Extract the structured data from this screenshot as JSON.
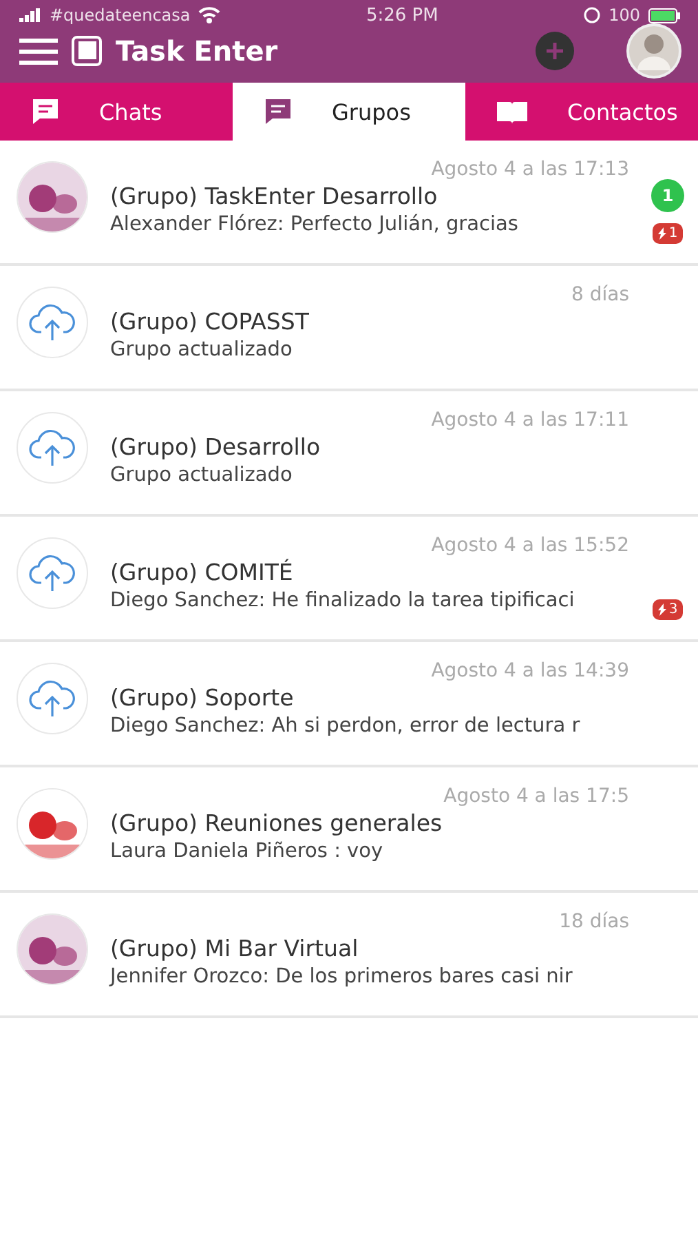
{
  "status_bar": {
    "carrier": "#quedateencasa",
    "time": "5:26 PM",
    "battery": "100"
  },
  "header": {
    "title": "Task Enter"
  },
  "tabs": [
    {
      "label": "Chats",
      "kind": "chat",
      "selected": false
    },
    {
      "label": "Grupos",
      "kind": "chat",
      "selected": true
    },
    {
      "label": "Contactos",
      "kind": "book",
      "selected": false
    }
  ],
  "groups": [
    {
      "kind": "picture",
      "name": "(Grupo) TaskEnter Desarrollo",
      "time": "Agosto 4 a las 17:13",
      "preview": "Alexander Flórez: Perfecto Julián, gracias",
      "unread": "1",
      "flags": "1"
    },
    {
      "kind": "cloud",
      "name": "(Grupo) COPASST",
      "time": "8 días",
      "preview": "Grupo actualizado"
    },
    {
      "kind": "cloud",
      "name": "(Grupo) Desarrollo",
      "time": "Agosto 4 a las 17:11",
      "preview": "Grupo actualizado"
    },
    {
      "kind": "cloud",
      "name": "(Grupo) COMITÉ",
      "time": "Agosto 4 a las 15:52",
      "preview": "Diego Sanchez: He finalizado la tarea tipificaci",
      "flags": "3"
    },
    {
      "kind": "cloud",
      "name": "(Grupo) Soporte",
      "time": "Agosto 4 a las 14:39",
      "preview": "Diego Sanchez: Ah si perdon, error de lectura r"
    },
    {
      "kind": "picture",
      "name": "(Grupo) Reuniones generales",
      "time": "Agosto 4 a las 17:5",
      "preview": "Laura Daniela Piñeros : voy"
    },
    {
      "kind": "picture",
      "name": "(Grupo) Mi Bar Virtual",
      "time": "18 días",
      "preview": "Jennifer Orozco: De los primeros bares casi nir"
    }
  ]
}
